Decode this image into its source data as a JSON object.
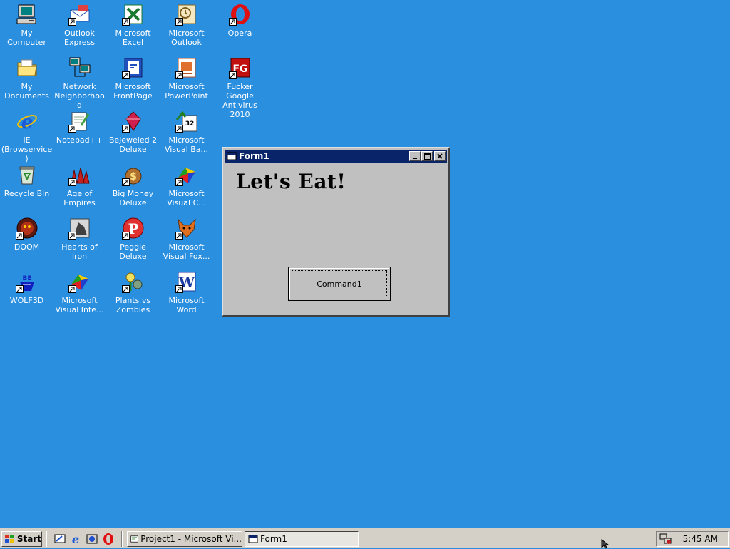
{
  "desktop": {
    "icons": [
      {
        "label": "My Computer",
        "icon": "computer-icon"
      },
      {
        "label": "Outlook Express",
        "icon": "outlook-express-icon"
      },
      {
        "label": "Microsoft Excel",
        "icon": "excel-icon"
      },
      {
        "label": "Microsoft Outlook",
        "icon": "outlook-icon"
      },
      {
        "label": "Opera",
        "icon": "opera-icon"
      },
      {
        "label": "My Documents",
        "icon": "folder-icon"
      },
      {
        "label": "Network Neighborhood",
        "icon": "network-icon"
      },
      {
        "label": "Microsoft FrontPage",
        "icon": "frontpage-icon"
      },
      {
        "label": "Microsoft PowerPoint",
        "icon": "powerpoint-icon"
      },
      {
        "label": "Fucker Google Antivirus 2010",
        "icon": "antivirus-icon"
      },
      {
        "label": "IE (Browservice)",
        "icon": "ie-icon"
      },
      {
        "label": "Notepad++",
        "icon": "notepad-icon"
      },
      {
        "label": "Bejeweled 2 Deluxe",
        "icon": "bejeweled-icon"
      },
      {
        "label": "Microsoft Visual Ba...",
        "icon": "visual-basic-icon"
      },
      {
        "label": "Recycle Bin",
        "icon": "recycle-bin-icon"
      },
      {
        "label": "Age of Empires",
        "icon": "age-of-empires-icon"
      },
      {
        "label": "Big Money Deluxe",
        "icon": "big-money-icon"
      },
      {
        "label": "Microsoft Visual C...",
        "icon": "visual-c-icon"
      },
      {
        "label": "DOOM",
        "icon": "doom-icon"
      },
      {
        "label": "Hearts of Iron",
        "icon": "hearts-of-iron-icon"
      },
      {
        "label": "Peggle Deluxe",
        "icon": "peggle-icon"
      },
      {
        "label": "Microsoft Visual Fox...",
        "icon": "visual-foxpro-icon"
      },
      {
        "label": "WOLF3D",
        "icon": "wolf3d-icon"
      },
      {
        "label": "Microsoft Visual Inte...",
        "icon": "visual-interdev-icon"
      },
      {
        "label": "Plants vs Zombies",
        "icon": "plants-vs-zombies-icon"
      },
      {
        "label": "Microsoft Word",
        "icon": "word-icon"
      }
    ]
  },
  "window": {
    "title": "Form1",
    "heading": "Let's Eat!",
    "command_label": "Command1"
  },
  "taskbar": {
    "start_label": "Start",
    "quick_launch": [
      "show-desktop-icon",
      "ie-icon",
      "channels-icon",
      "opera-icon"
    ],
    "tasks": [
      {
        "label": "Project1 - Microsoft Vi...",
        "pressed": false
      },
      {
        "label": "Form1",
        "pressed": true
      }
    ],
    "clock": "5:45 AM"
  },
  "colors": {
    "desktop": "#2b8fe0",
    "titlebar": "#0a246a",
    "face": "#c0c0c0"
  }
}
